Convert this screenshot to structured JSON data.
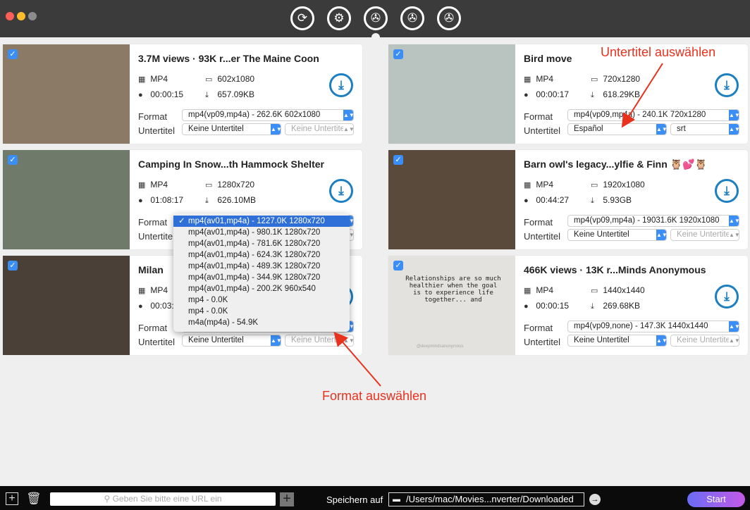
{
  "toolbar": {
    "buttons": [
      "convert-icon",
      "convert-settings-icon",
      "video-download-icon",
      "video-split-icon",
      "video-edit-icon"
    ]
  },
  "labels": {
    "format": "Format",
    "subtitle": "Untertitel"
  },
  "cards": [
    {
      "title": "3.7M views · 93K r...er The Maine Coon",
      "container": "MP4",
      "resolution": "602x1080",
      "duration": "00:00:15",
      "size": "657.09KB",
      "format": "mp4(vp09,mp4a) - 262.6K 602x1080",
      "subtitle": "Keine Untertitel",
      "subtitle_format": "Keine Untertitel",
      "subtitle_format_disabled": true,
      "thumb": "#8a7a66"
    },
    {
      "title": "Bird move",
      "container": "MP4",
      "resolution": "720x1280",
      "duration": "00:00:17",
      "size": "618.29KB",
      "format": "mp4(vp09,mp4a) - 240.1K 720x1280",
      "subtitle": "Español",
      "subtitle_format": "srt",
      "subtitle_format_disabled": false,
      "thumb": "#b9c4c0"
    },
    {
      "title": "Camping In Snow...th Hammock Shelter",
      "container": "MP4",
      "resolution": "1280x720",
      "duration": "01:08:17",
      "size": "626.10MB",
      "format": "mp4(av01,mp4a) - 1227.0K 1280x720",
      "subtitle": "Keine Untertitel",
      "subtitle_format": "Keine Untertitel",
      "subtitle_format_disabled": true,
      "thumb": "#6f7a6a"
    },
    {
      "title": "Barn owl's legacy...ylfie & Finn 🦉💕🦉",
      "container": "MP4",
      "resolution": "1920x1080",
      "duration": "00:44:27",
      "size": "5.93GB",
      "format": "mp4(vp09,mp4a) - 19031.6K 1920x1080",
      "subtitle": "Keine Untertitel",
      "subtitle_format": "Keine Untertitel",
      "subtitle_format_disabled": true,
      "thumb": "#5a4a3c"
    },
    {
      "title": "Milan",
      "container": "MP4",
      "resolution": "",
      "duration": "00:03:",
      "size": "",
      "format": "",
      "subtitle": "Keine Untertitel",
      "subtitle_format": "Keine Untertitel",
      "subtitle_format_disabled": true,
      "thumb": "#4a4038"
    },
    {
      "title": "466K views · 13K r...Minds Anonymous",
      "container": "MP4",
      "resolution": "1440x1440",
      "duration": "00:00:15",
      "size": "269.68KB",
      "format": "mp4(vp09,none) - 147.3K 1440x1440",
      "subtitle": "Keine Untertitel",
      "subtitle_format": "Keine Untertitel",
      "subtitle_format_disabled": true,
      "thumb": "#e3e2de",
      "quote": "Relationships are so much healthier when the goal is to experience life together... and",
      "watermark": "@deepmindsanonymous"
    }
  ],
  "format_menu": {
    "selected": 0,
    "options": [
      "mp4(av01,mp4a) - 1227.0K 1280x720",
      "mp4(av01,mp4a) - 980.1K 1280x720",
      "mp4(av01,mp4a) - 781.6K 1280x720",
      "mp4(av01,mp4a) - 624.3K 1280x720",
      "mp4(av01,mp4a) - 489.3K 1280x720",
      "mp4(av01,mp4a) - 344.9K 1280x720",
      "mp4(av01,mp4a) - 200.2K 960x540",
      "mp4 - 0.0K",
      "mp4 - 0.0K",
      "m4a(mp4a) - 54.9K"
    ]
  },
  "annotations": {
    "subtitle": "Untertitel auswählen",
    "format": "Format auswählen"
  },
  "bottom": {
    "url_placeholder": "Geben Sie bitte eine URL ein",
    "save_label": "Speichern auf",
    "save_path": "/Users/mac/Movies...nverter/Downloaded",
    "start": "Start"
  }
}
